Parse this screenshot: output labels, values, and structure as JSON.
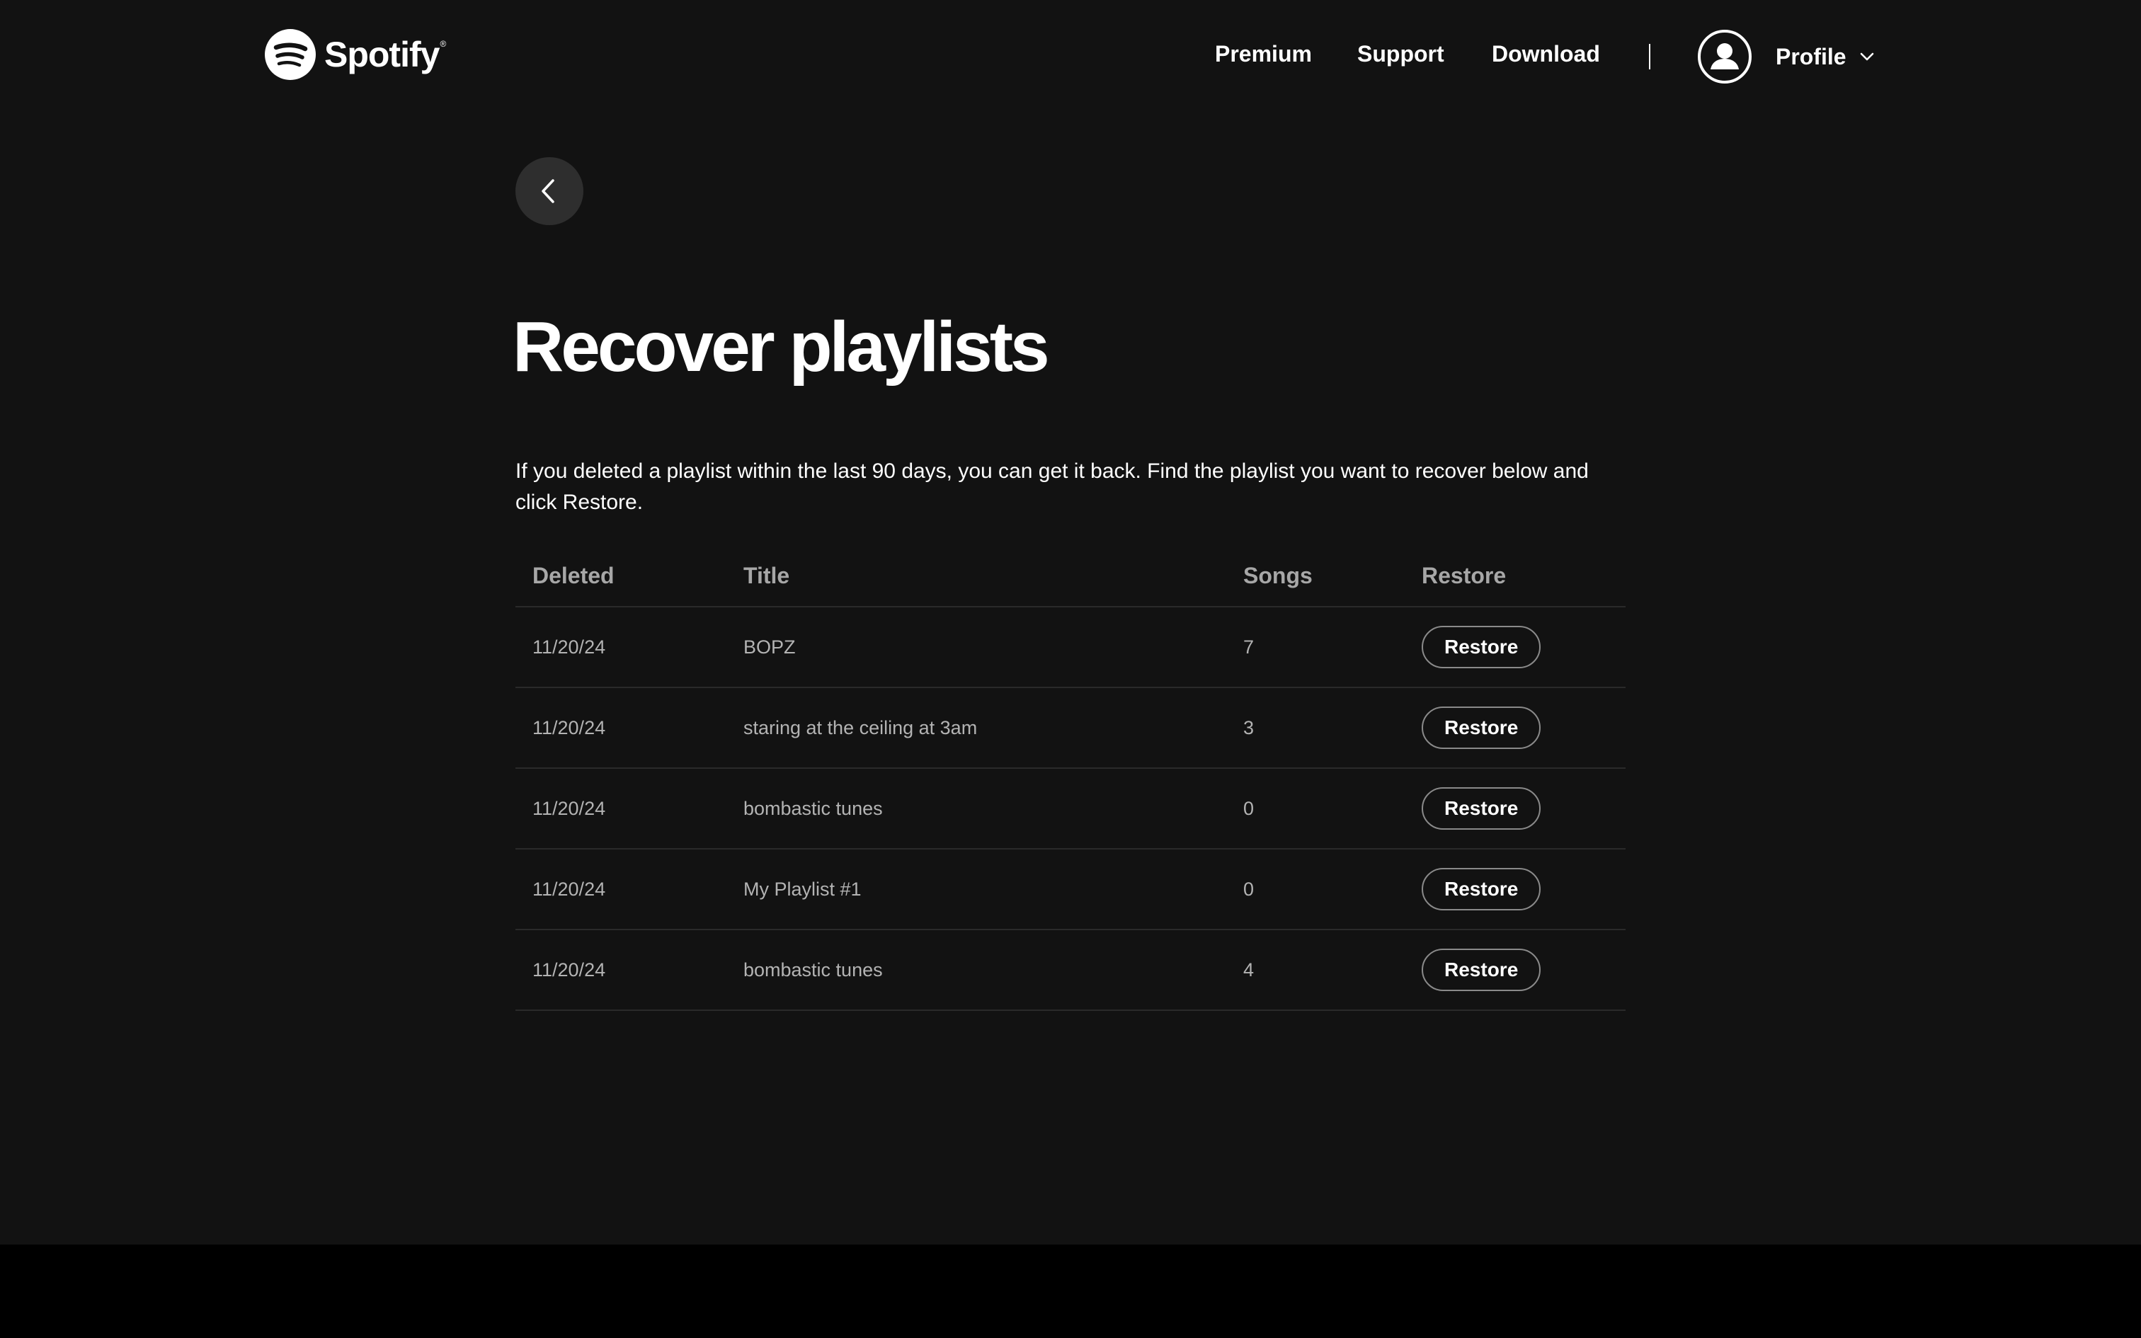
{
  "header": {
    "logo_text": "Spotify",
    "logo_trademark": "®",
    "nav": {
      "premium": "Premium",
      "support": "Support",
      "download": "Download"
    },
    "profile_label": "Profile"
  },
  "main": {
    "title": "Recover playlists",
    "description": "If you deleted a playlist within the last 90 days, you can get it back. Find the playlist you want to recover below and click Restore.",
    "table": {
      "headers": {
        "deleted": "Deleted",
        "title": "Title",
        "songs": "Songs",
        "restore": "Restore"
      },
      "rows": [
        {
          "deleted": "11/20/24",
          "title": "BOPZ",
          "songs": "7",
          "restore": "Restore"
        },
        {
          "deleted": "11/20/24",
          "title": "staring at the ceiling at 3am",
          "songs": "3",
          "restore": "Restore"
        },
        {
          "deleted": "11/20/24",
          "title": "bombastic tunes",
          "songs": "0",
          "restore": "Restore"
        },
        {
          "deleted": "11/20/24",
          "title": "My Playlist #1",
          "songs": "0",
          "restore": "Restore"
        },
        {
          "deleted": "11/20/24",
          "title": "bombastic tunes",
          "songs": "4",
          "restore": "Restore"
        }
      ]
    }
  },
  "icons": {
    "logo": "spotify-logo-icon",
    "avatar": "user-icon",
    "profile_menu": "chevron-down-icon",
    "back": "chevron-left-icon"
  },
  "colors": {
    "page_background": "#121212",
    "footer_background": "#000000",
    "text_primary": "#ffffff",
    "text_secondary": "#b3b3b3",
    "header_text": "#a7a7a7",
    "back_button_bg": "#2e2e2e",
    "divider": "#2a2a2a",
    "button_border": "#8a8a8a"
  }
}
